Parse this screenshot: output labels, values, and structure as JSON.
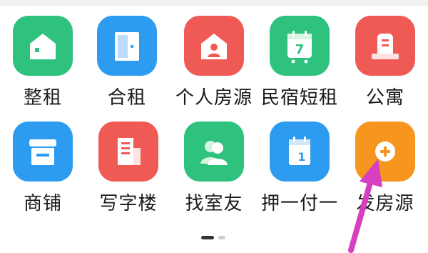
{
  "grid": {
    "items": [
      {
        "label": "整租",
        "color": "#2ec27e",
        "icon": "house-icon"
      },
      {
        "label": "合租",
        "color": "#2d9cf0",
        "icon": "door-icon"
      },
      {
        "label": "个人房源",
        "color": "#f05a55",
        "icon": "person-house-icon"
      },
      {
        "label": "民宿短租",
        "color": "#2ec27e",
        "icon": "calendar-7-icon"
      },
      {
        "label": "公寓",
        "color": "#f05a55",
        "icon": "building-icon"
      },
      {
        "label": "商铺",
        "color": "#2d9cf0",
        "icon": "shop-icon"
      },
      {
        "label": "写字楼",
        "color": "#f05a55",
        "icon": "office-building-icon"
      },
      {
        "label": "找室友",
        "color": "#2ec27e",
        "icon": "roommates-icon"
      },
      {
        "label": "押一付一",
        "color": "#2d9cf0",
        "icon": "calendar-1-icon"
      },
      {
        "label": "发房源",
        "color": "#f7961e",
        "icon": "plus-icon"
      }
    ]
  },
  "pagination": {
    "current": 1,
    "total": 2
  },
  "annotation": {
    "color": "#d63fbf",
    "icon": "arrow-icon"
  }
}
